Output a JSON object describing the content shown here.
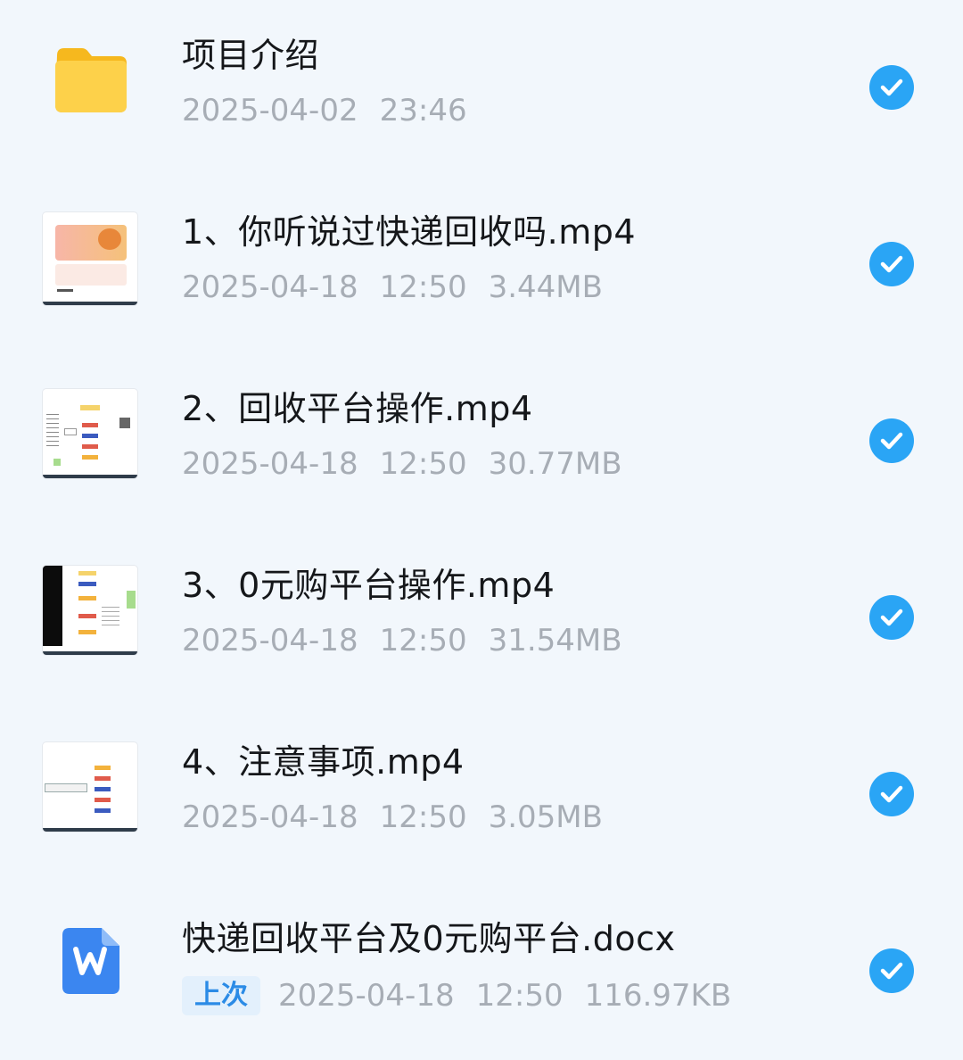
{
  "files": [
    {
      "type": "folder",
      "icon": "folder-icon",
      "name": "项目介绍",
      "date": "2025-04-02",
      "time": "23:46",
      "size": "",
      "selected": true
    },
    {
      "type": "video",
      "icon": "video-thumbnail",
      "name": "1、你听说过快递回收吗.mp4",
      "date": "2025-04-18",
      "time": "12:50",
      "size": "3.44MB",
      "selected": true
    },
    {
      "type": "video",
      "icon": "video-thumbnail",
      "name": "2、回收平台操作.mp4",
      "date": "2025-04-18",
      "time": "12:50",
      "size": "30.77MB",
      "selected": true
    },
    {
      "type": "video",
      "icon": "video-thumbnail",
      "name": "3、0元购平台操作.mp4",
      "date": "2025-04-18",
      "time": "12:50",
      "size": "31.54MB",
      "selected": true
    },
    {
      "type": "video",
      "icon": "video-thumbnail",
      "name": "4、注意事项.mp4",
      "date": "2025-04-18",
      "time": "12:50",
      "size": "3.05MB",
      "selected": true
    },
    {
      "type": "document",
      "icon": "word-doc-icon",
      "name": "快递回收平台及0元购平台.docx",
      "tag": "上次",
      "date": "2025-04-18",
      "time": "12:50",
      "size": "116.97KB",
      "selected": true
    }
  ],
  "colors": {
    "background": "#f2f7fc",
    "check": "#2aa5f5",
    "title": "#15171a",
    "meta": "#a7adb5",
    "tag_text": "#2b8be6",
    "folder": "#fcc43a",
    "word": "#3b86f0"
  }
}
